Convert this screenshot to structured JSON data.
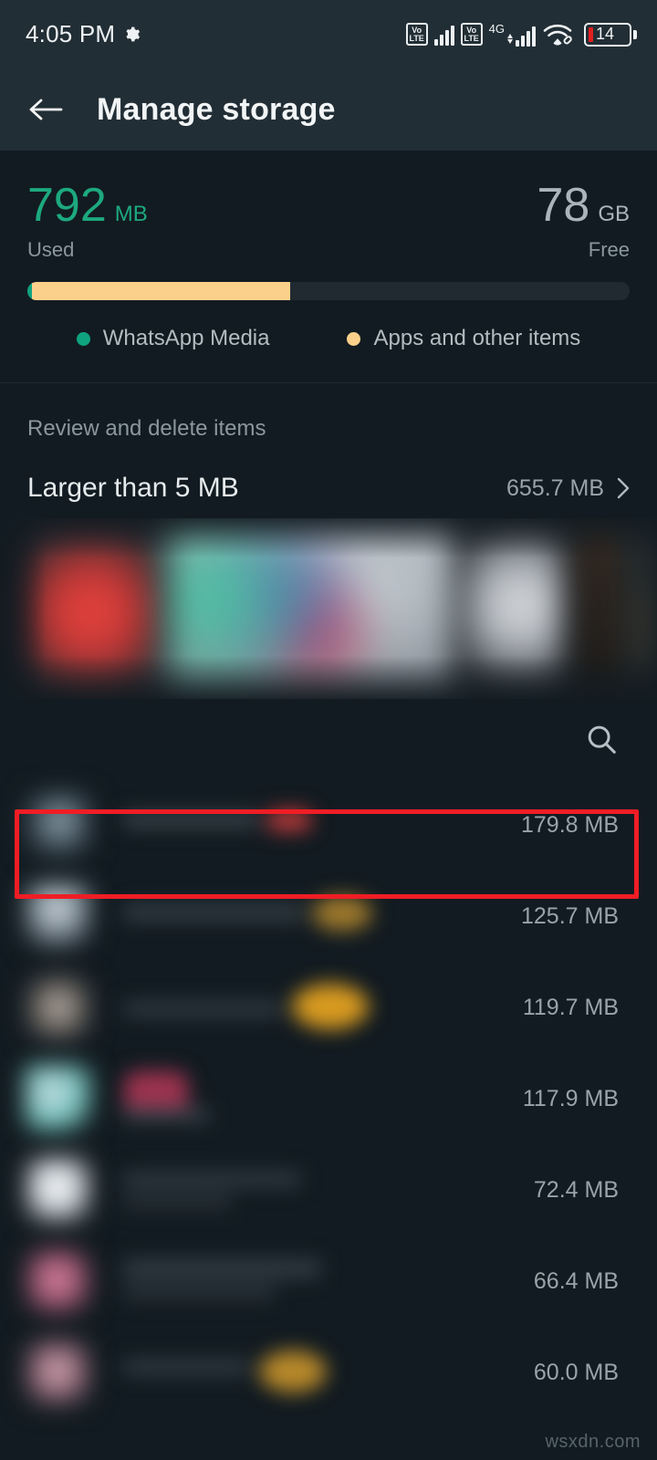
{
  "status_bar": {
    "time": "4:05 PM",
    "gear_icon": "gear-icon",
    "volte_top": "Vo",
    "volte_bottom": "LTE",
    "network_label": "4G",
    "battery_level": "14",
    "wifi_icon": "wifi-icon"
  },
  "app_bar": {
    "back_icon": "back-arrow-icon",
    "title": "Manage storage"
  },
  "storage_summary": {
    "used_value": "792",
    "used_unit": "MB",
    "used_label": "Used",
    "free_value": "78",
    "free_unit": "GB",
    "free_label": "Free",
    "legend": [
      {
        "label": "WhatsApp Media",
        "color": "#10a37f"
      },
      {
        "label": "Apps and other items",
        "color": "#fbd08a"
      }
    ]
  },
  "review_section": {
    "heading": "Review and delete items",
    "larger_than": {
      "label": "Larger than 5 MB",
      "size": "655.7 MB",
      "chevron_icon": "chevron-right-icon"
    }
  },
  "search": {
    "icon": "search-icon"
  },
  "file_list": {
    "rows": [
      {
        "size": "179.8 MB",
        "highlighted": true
      },
      {
        "size": "125.7 MB",
        "highlighted": false
      },
      {
        "size": "119.7 MB",
        "highlighted": false
      },
      {
        "size": "117.9 MB",
        "highlighted": false
      },
      {
        "size": "72.4 MB",
        "highlighted": false
      },
      {
        "size": "66.4 MB",
        "highlighted": false
      },
      {
        "size": "60.0 MB",
        "highlighted": false
      }
    ]
  },
  "highlight_color": "#f01d25",
  "watermark": "wsxdn.com"
}
